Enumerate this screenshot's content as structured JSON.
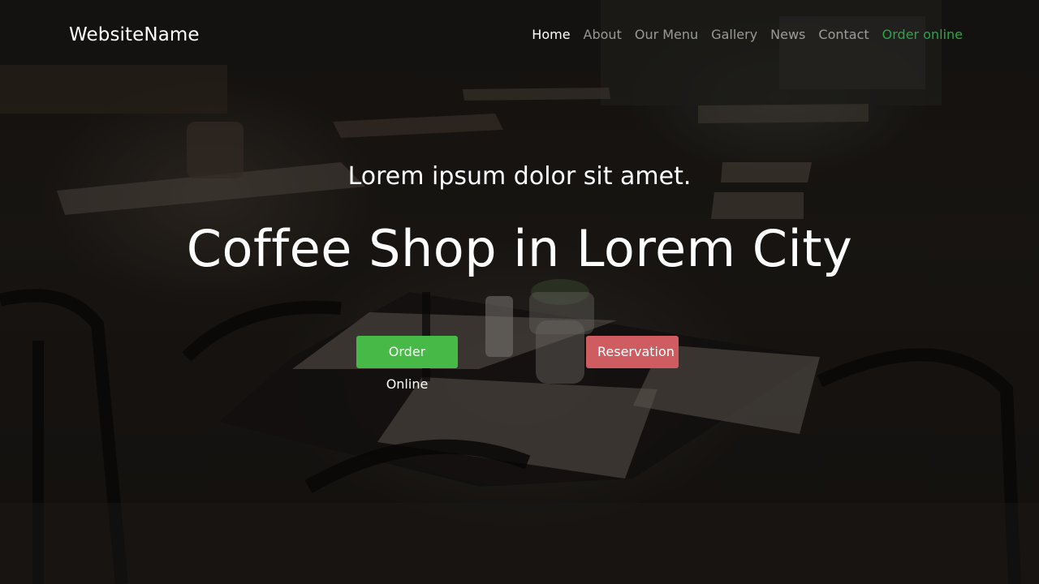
{
  "brand": {
    "name": "WebsiteName"
  },
  "nav": {
    "items": [
      {
        "label": "Home"
      },
      {
        "label": "About"
      },
      {
        "label": "Our Menu"
      },
      {
        "label": "Gallery"
      },
      {
        "label": "News"
      },
      {
        "label": "Contact"
      },
      {
        "label": "Order online"
      }
    ]
  },
  "hero": {
    "tagline": "Lorem ipsum dolor sit amet.",
    "headline": "Coffee Shop in Lorem City",
    "order_button": "Order Online",
    "reservation_button": "Reservation"
  },
  "colors": {
    "accent_green": "#46b946",
    "nav_order_green": "#28a745",
    "reservation_red": "#cf5c60"
  }
}
